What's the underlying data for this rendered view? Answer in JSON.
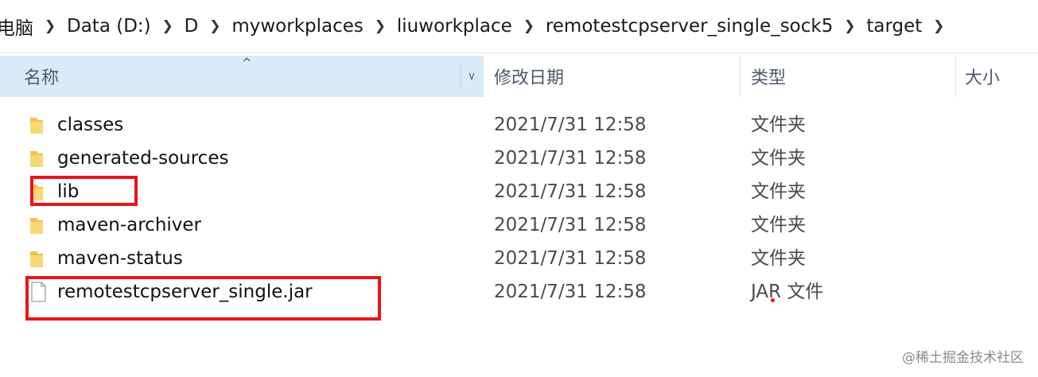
{
  "breadcrumb": {
    "items": [
      "电脑",
      "Data (D:)",
      "D",
      "myworkplaces",
      "liuworkplace",
      "remotestcpserver_single_sock5",
      "target"
    ],
    "separator_icon": "chevron-right-icon"
  },
  "columns": {
    "name": "名称",
    "date": "修改日期",
    "type": "类型",
    "size": "大小"
  },
  "files": [
    {
      "name": "classes",
      "date": "2021/7/31 12:58",
      "type": "文件夹",
      "icon": "folder-icon"
    },
    {
      "name": "generated-sources",
      "date": "2021/7/31 12:58",
      "type": "文件夹",
      "icon": "folder-icon"
    },
    {
      "name": "lib",
      "date": "2021/7/31 12:58",
      "type": "文件夹",
      "icon": "folder-icon"
    },
    {
      "name": "maven-archiver",
      "date": "2021/7/31 12:58",
      "type": "文件夹",
      "icon": "folder-icon"
    },
    {
      "name": "maven-status",
      "date": "2021/7/31 12:58",
      "type": "文件夹",
      "icon": "folder-icon"
    },
    {
      "name": "remotestcpserver_single.jar",
      "date": "2021/7/31 12:58",
      "type": "JAR 文件",
      "icon": "file-icon"
    }
  ],
  "watermark": "@稀土掘金技术社区",
  "colors": {
    "header_bg": "#d9ebf9",
    "highlight": "#e8141a",
    "folder": "#f4c04a"
  }
}
